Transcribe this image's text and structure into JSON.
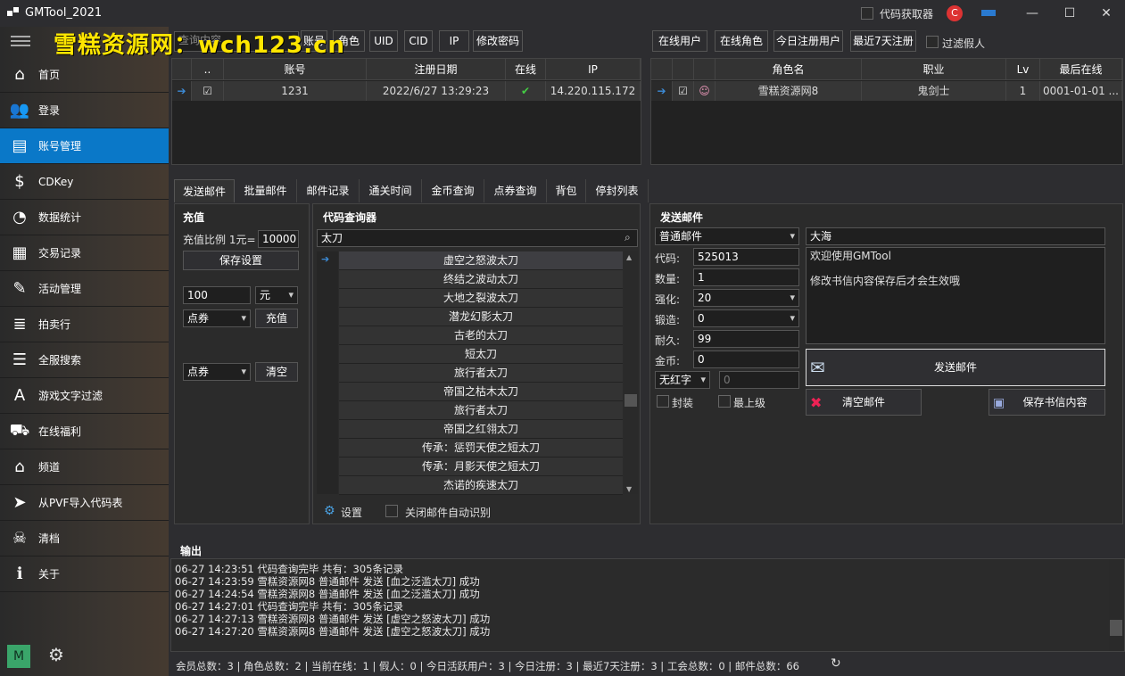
{
  "window": {
    "title": "GMTool_2021",
    "code_fetcher_label": "代码获取器"
  },
  "watermark": "雪糕资源网：wch123.cn",
  "sidebar": {
    "items": [
      {
        "label": "首页",
        "icon": "home-icon",
        "glyph": "⌂"
      },
      {
        "label": "登录",
        "icon": "users-icon",
        "glyph": "👥"
      },
      {
        "label": "账号管理",
        "icon": "account-icon",
        "glyph": "▤"
      },
      {
        "label": "CDKey",
        "icon": "dollar-icon",
        "glyph": "$"
      },
      {
        "label": "数据统计",
        "icon": "chart-disk-icon",
        "glyph": "◔"
      },
      {
        "label": "交易记录",
        "icon": "log-icon",
        "glyph": "▦"
      },
      {
        "label": "活动管理",
        "icon": "ticket-icon",
        "glyph": "✎"
      },
      {
        "label": "拍卖行",
        "icon": "database-icon",
        "glyph": "≣"
      },
      {
        "label": "全服搜索",
        "icon": "server-icon",
        "glyph": "☰"
      },
      {
        "label": "游戏文字过滤",
        "icon": "text-filter-icon",
        "glyph": "A"
      },
      {
        "label": "在线福利",
        "icon": "truck-icon",
        "glyph": "⛟"
      },
      {
        "label": "频道",
        "icon": "factory-icon",
        "glyph": "⌂"
      },
      {
        "label": "从PVF导入代码表",
        "icon": "cursor-icon",
        "glyph": "➤"
      },
      {
        "label": "清档",
        "icon": "skull-icon",
        "glyph": "☠"
      },
      {
        "label": "关于",
        "icon": "info-icon",
        "glyph": "ℹ"
      }
    ],
    "active_index": 2,
    "user_initial": "M"
  },
  "toolbar_left": {
    "search_placeholder": "查询内容",
    "buttons": [
      "账号",
      "角色",
      "UID",
      "CID",
      "IP",
      "修改密码"
    ]
  },
  "toolbar_right": {
    "buttons": [
      "在线用户",
      "在线角色",
      "今日注册用户",
      "最近7天注册"
    ],
    "filter_label": "过滤假人"
  },
  "account_grid": {
    "headers": [
      "..",
      "账号",
      "注册日期",
      "在线",
      "IP"
    ],
    "rows": [
      {
        "account": "1231",
        "date": "2022/6/27 13:29:23",
        "online": "✔",
        "ip": "14.220.115.172"
      }
    ]
  },
  "role_grid": {
    "headers": [
      "角色名",
      "职业",
      "Lv",
      "最后在线"
    ],
    "rows": [
      {
        "name": "雪糕资源网8",
        "job": "鬼剑士",
        "lv": "1",
        "last": "0001-01-01 ..."
      }
    ]
  },
  "tabs": [
    "发送邮件",
    "批量邮件",
    "邮件记录",
    "通关时间",
    "金币查询",
    "点券查询",
    "背包",
    "停封列表"
  ],
  "recharge": {
    "title": "充值",
    "ratio_label": "充值比例 1元=",
    "ratio_value": "10000",
    "save_btn": "保存设置",
    "amount": "100",
    "unit": "元",
    "type1": "点券",
    "recharge_btn": "充值",
    "type2": "点券",
    "clear_btn": "清空"
  },
  "code_query": {
    "title": "代码查询器",
    "search": "太刀",
    "items": [
      "虚空之怒波太刀",
      "终结之波动太刀",
      "大地之裂波太刀",
      "潜龙幻影太刀",
      "古老的太刀",
      "短太刀",
      "旅行者太刀",
      "帝国之枯木太刀",
      "旅行者太刀",
      "帝国之红翎太刀",
      "传承：惩罚天使之短太刀",
      "传承：月影天使之短太刀",
      "杰诺的疾速太刀"
    ],
    "settings_label": "设置",
    "auto_label": "关闭邮件自动识别"
  },
  "send_mail": {
    "title": "发送邮件",
    "mail_type": "普通邮件",
    "sender": "大海",
    "code_label": "代码:",
    "code": "525013",
    "qty_label": "数量:",
    "qty": "1",
    "enh_label": "强化:",
    "enh": "20",
    "forge_label": "锻造:",
    "forge": "0",
    "dur_label": "耐久:",
    "dur": "99",
    "gold_label": "金币:",
    "gold": "0",
    "red_label": "无红字",
    "red_val": "0",
    "seal_label": "封装",
    "maxlv_label": "最上级",
    "body_line1": "欢迎使用GMTool",
    "body_line2": "修改书信内容保存后才会生效哦",
    "send_btn": "发送邮件",
    "clear_btn": "清空邮件",
    "save_btn": "保存书信内容"
  },
  "output": {
    "title": "输出",
    "lines": [
      "06-27 14:23:51 代码查询完毕 共有：305条记录",
      "06-27 14:23:59 雪糕资源网8 普通邮件 发送 [血之泛滥太刀] 成功",
      "06-27 14:24:54 雪糕资源网8 普通邮件 发送 [血之泛滥太刀] 成功",
      "06-27 14:27:01 代码查询完毕 共有：305条记录",
      "06-27 14:27:13 雪糕资源网8 普通邮件 发送 [虚空之怒波太刀] 成功",
      "06-27 14:27:20 雪糕资源网8 普通邮件 发送 [虚空之怒波太刀] 成功"
    ]
  },
  "status": "会员总数：3 | 角色总数：2 | 当前在线：1 | 假人：0 | 今日活跃用户：3 | 今日注册：3 | 最近7天注册：3 | 工会总数：0 | 邮件总数：66"
}
